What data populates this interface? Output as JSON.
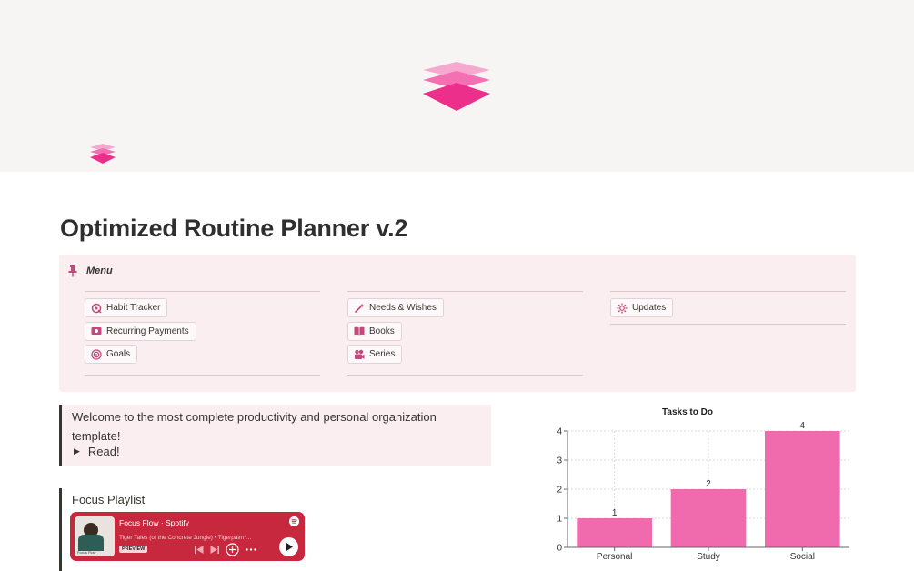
{
  "cover": {
    "logo_icon": "stacked-layers-icon"
  },
  "page": {
    "icon": "stacked-layers-icon",
    "title": "Optimized Routine Planner v.2"
  },
  "menu": {
    "title": "Menu",
    "icon": "pin-icon",
    "columns": [
      {
        "items": [
          {
            "label": "Habit Tracker",
            "icon": "habit-tracker-icon"
          },
          {
            "label": "Recurring Payments",
            "icon": "money-icon"
          },
          {
            "label": "Goals",
            "icon": "target-icon"
          }
        ]
      },
      {
        "items": [
          {
            "label": "Needs & Wishes",
            "icon": "magic-wand-icon"
          },
          {
            "label": "Books",
            "icon": "book-icon"
          },
          {
            "label": "Series",
            "icon": "film-icon"
          }
        ]
      },
      {
        "items": [
          {
            "label": "Updates",
            "icon": "gear-icon"
          }
        ]
      }
    ]
  },
  "welcome": {
    "text": "Welcome to the most complete productivity and personal organization template!",
    "toggle_label": "Read!"
  },
  "playlist": {
    "heading": "Focus Playlist",
    "player": {
      "title": "Focus Flow · Spotify",
      "subtitle": "Tiger Tales (of the Concrete Jungle) • Tigerpalm*...",
      "badge": "PREVIEW",
      "art_label": "Focus Flow"
    }
  },
  "colors": {
    "accent": "#f06aae",
    "cover_bg": "#f7f5f4",
    "callout_bg": "#fbeef1",
    "spotify_red": "#c8283d"
  },
  "chart_data": {
    "type": "bar",
    "title": "Tasks to Do",
    "categories": [
      "Personal",
      "Study",
      "Social"
    ],
    "values": [
      1,
      2,
      4
    ],
    "ylim": [
      0,
      4
    ],
    "yticks": [
      0,
      1,
      2,
      3,
      4
    ],
    "grid": true,
    "bar_color": "#f06aae"
  }
}
